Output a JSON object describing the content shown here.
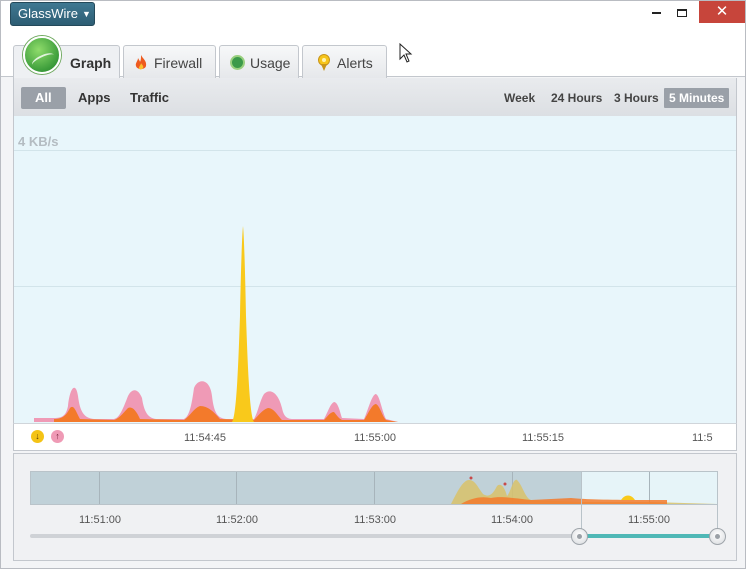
{
  "app_menu": {
    "label": "GlassWire"
  },
  "window_controls": {
    "close_glyph": "✕"
  },
  "tabs": [
    {
      "label": "Graph",
      "icon": "graph-logo-icon",
      "active": true
    },
    {
      "label": "Firewall",
      "icon": "flame-icon"
    },
    {
      "label": "Usage",
      "icon": "usage-icon"
    },
    {
      "label": "Alerts",
      "icon": "alert-pin-icon"
    }
  ],
  "filters": [
    {
      "label": "All",
      "active": true
    },
    {
      "label": "Apps"
    },
    {
      "label": "Traffic"
    }
  ],
  "ranges": [
    {
      "label": "Week"
    },
    {
      "label": "24 Hours"
    },
    {
      "label": "3 Hours"
    },
    {
      "label": "5 Minutes",
      "active": true
    }
  ],
  "graph": {
    "rate_label": "4 KB/s",
    "legend_down_glyph": "↓",
    "legend_up_glyph": "↑",
    "ticks": [
      "11:54:45",
      "11:55:00",
      "11:55:15",
      "11:5"
    ]
  },
  "overview": {
    "ticks": [
      "11:51:00",
      "11:52:00",
      "11:53:00",
      "11:54:00",
      "11:55:00"
    ]
  },
  "colors": {
    "download": "#f9c91b",
    "upload": "#f090ae",
    "overlap": "#f37a2b",
    "accent": "#4fb8b6"
  }
}
